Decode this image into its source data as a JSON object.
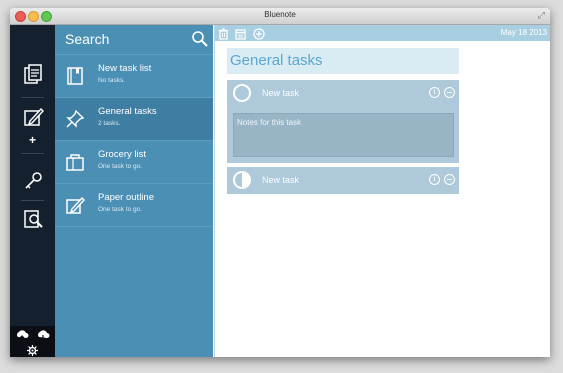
{
  "window": {
    "title": "Bluenote"
  },
  "sidebar": {
    "icons": [
      {
        "name": "notes-icon"
      },
      {
        "name": "edit-icon"
      },
      {
        "name": "add-icon"
      },
      {
        "name": "key-icon"
      },
      {
        "name": "search-doc-icon"
      }
    ],
    "bottom_icons": [
      {
        "name": "cloud-upload-icon"
      },
      {
        "name": "cloud-download-icon"
      },
      {
        "name": "settings-gear-icon"
      }
    ]
  },
  "list": {
    "search_label": "Search",
    "items": [
      {
        "title": "New task list",
        "subtitle": "No tasks.",
        "icon": "book-icon",
        "active": false
      },
      {
        "title": "General tasks",
        "subtitle": "2 tasks.",
        "icon": "pin-icon",
        "active": true
      },
      {
        "title": "Grocery list",
        "subtitle": "One task to go.",
        "icon": "bag-icon",
        "active": false
      },
      {
        "title": "Paper outline",
        "subtitle": "One task to go.",
        "icon": "pencil-icon",
        "active": false
      }
    ]
  },
  "toolbar": {
    "date": "May 18 2013",
    "icons": [
      "trash-icon",
      "calendar-icon",
      "add-circle-icon"
    ]
  },
  "main": {
    "group_title": "General tasks",
    "tasks": [
      {
        "title": "New task",
        "notes_placeholder": "Notes for this task",
        "expanded": true,
        "progress": 0
      },
      {
        "title": "New task",
        "expanded": false,
        "progress": 0.5
      }
    ]
  }
}
